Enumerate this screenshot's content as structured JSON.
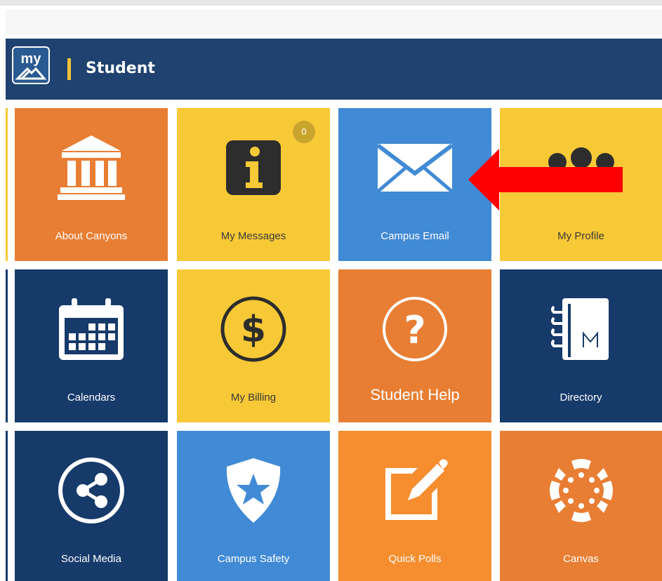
{
  "header": {
    "title": "Student",
    "logo_text": "my"
  },
  "colors": {
    "header": "#1f4270",
    "orange": "#e87e33",
    "yellow": "#f8c936",
    "blue": "#418ad5",
    "navy": "#163a6a",
    "accent": "#f6c23a",
    "arrow": "#ff0000"
  },
  "tiles": [
    {
      "label": "About Canyons",
      "icon": "building-icon"
    },
    {
      "label": "My Messages",
      "icon": "info-icon",
      "badge": "0"
    },
    {
      "label": "Campus Email",
      "icon": "envelope-icon"
    },
    {
      "label": "My Profile",
      "icon": "people-icon"
    },
    {
      "label": "Calendars",
      "icon": "calendar-icon"
    },
    {
      "label": "My Billing",
      "icon": "dollar-icon"
    },
    {
      "label": "Student Help",
      "icon": "question-icon"
    },
    {
      "label": "Directory",
      "icon": "notebook-icon"
    },
    {
      "label": "Social Media",
      "icon": "share-icon"
    },
    {
      "label": "Campus Safety",
      "icon": "badge-star-icon"
    },
    {
      "label": "Quick Polls",
      "icon": "edit-icon"
    },
    {
      "label": "Canvas",
      "icon": "canvas-icon"
    }
  ],
  "annotation": {
    "icon": "red-arrow-icon"
  }
}
